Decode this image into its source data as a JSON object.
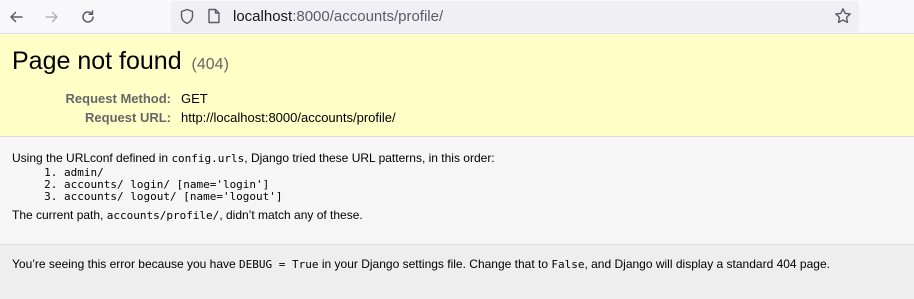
{
  "browser": {
    "url_host": "localhost",
    "url_rest": ":8000/accounts/profile/"
  },
  "summary": {
    "title": "Page not found",
    "status_code": "(404)",
    "request_method_label": "Request Method:",
    "request_method_value": "GET",
    "request_url_label": "Request URL:",
    "request_url_value": "http://localhost:8000/accounts/profile/"
  },
  "info": {
    "intro_before": "Using the URLconf defined in ",
    "intro_code": "config.urls",
    "intro_after": ", Django tried these URL patterns, in this order:",
    "patterns": [
      "admin/",
      "accounts/ login/ [name='login']",
      "accounts/ logout/ [name='logout']"
    ],
    "current_before": "The current path, ",
    "current_code": "accounts/profile/",
    "current_after": ", didn’t match any of these."
  },
  "explanation": {
    "part1": "You’re seeing this error because you have ",
    "code1": "DEBUG = True",
    "part2": " in your Django settings file. Change that to ",
    "code2": "False",
    "part3": ", and Django will display a standard 404 page."
  }
}
